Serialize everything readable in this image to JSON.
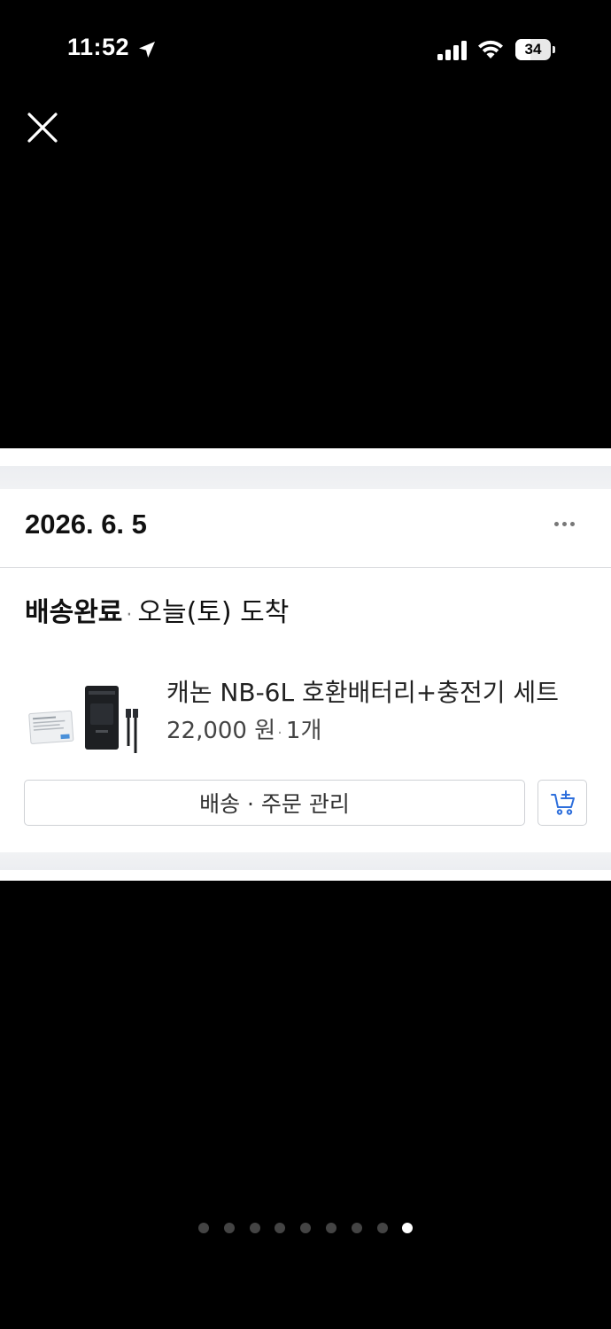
{
  "status_bar": {
    "time": "11:52",
    "battery": "34"
  },
  "viewer": {
    "close_icon": "close-icon"
  },
  "order_card": {
    "date": "2026. 6. 5",
    "status_label": "배송완료",
    "status_separator": "·",
    "arrival_text": "오늘(토) 도착",
    "product": {
      "name": "캐논 NB-6L 호환배터리+충전기 세트",
      "price": "22,000 원",
      "separator": "·",
      "quantity": "1개"
    },
    "manage_button_label": "배송 · 주문 관리",
    "cart_icon": "add-to-cart-icon"
  },
  "pagination": {
    "total": 9,
    "active_index": 8
  }
}
